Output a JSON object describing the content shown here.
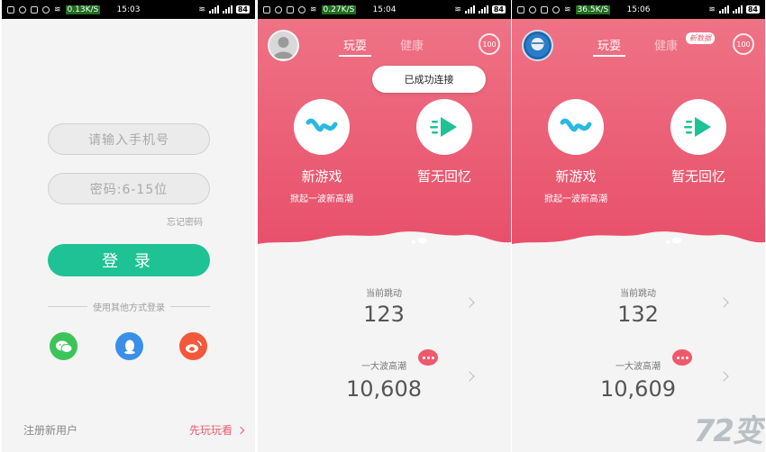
{
  "status_bars": [
    {
      "speed": "0.13K/S",
      "time": "15:03",
      "battery": "84"
    },
    {
      "speed": "0.27K/S",
      "time": "15:04",
      "battery": "84"
    },
    {
      "speed": "36.5K/S",
      "time": "15:06",
      "battery": "84"
    }
  ],
  "login": {
    "phone_placeholder": "请输入手机号",
    "password_placeholder": "密码:6-15位",
    "forgot_password": "忘记密码",
    "login_button": "登 录",
    "other_login": "使用其他方式登录",
    "social": [
      "wechat-icon",
      "qq-icon",
      "weibo-icon"
    ],
    "register": "注册新用户",
    "try_play": "先玩玩看"
  },
  "game_screens": [
    {
      "tabs": [
        "玩耍",
        "健康"
      ],
      "badge": "100",
      "toast": "已成功连接",
      "new_game": {
        "title": "新游戏",
        "subtitle": "掀起一波新高潮"
      },
      "no_memory": {
        "title": "暂无回忆"
      },
      "current_beat": {
        "label": "当前跳动",
        "value": "123"
      },
      "big_wave": {
        "label": "一大波高潮",
        "value": "10,608"
      }
    },
    {
      "tabs": [
        "玩耍",
        "健康"
      ],
      "new_data_tag": "新数据",
      "badge": "100",
      "new_game": {
        "title": "新游戏",
        "subtitle": "掀起一波新高潮"
      },
      "no_memory": {
        "title": "暂无回忆"
      },
      "current_beat": {
        "label": "当前跳动",
        "value": "132"
      },
      "big_wave": {
        "label": "一大波高潮",
        "value": "10,609"
      }
    }
  ],
  "colors": {
    "accent_green": "#1fc295",
    "hero_pink": "#e9536d",
    "try_red": "#ef5b6e"
  },
  "watermark": "72变"
}
